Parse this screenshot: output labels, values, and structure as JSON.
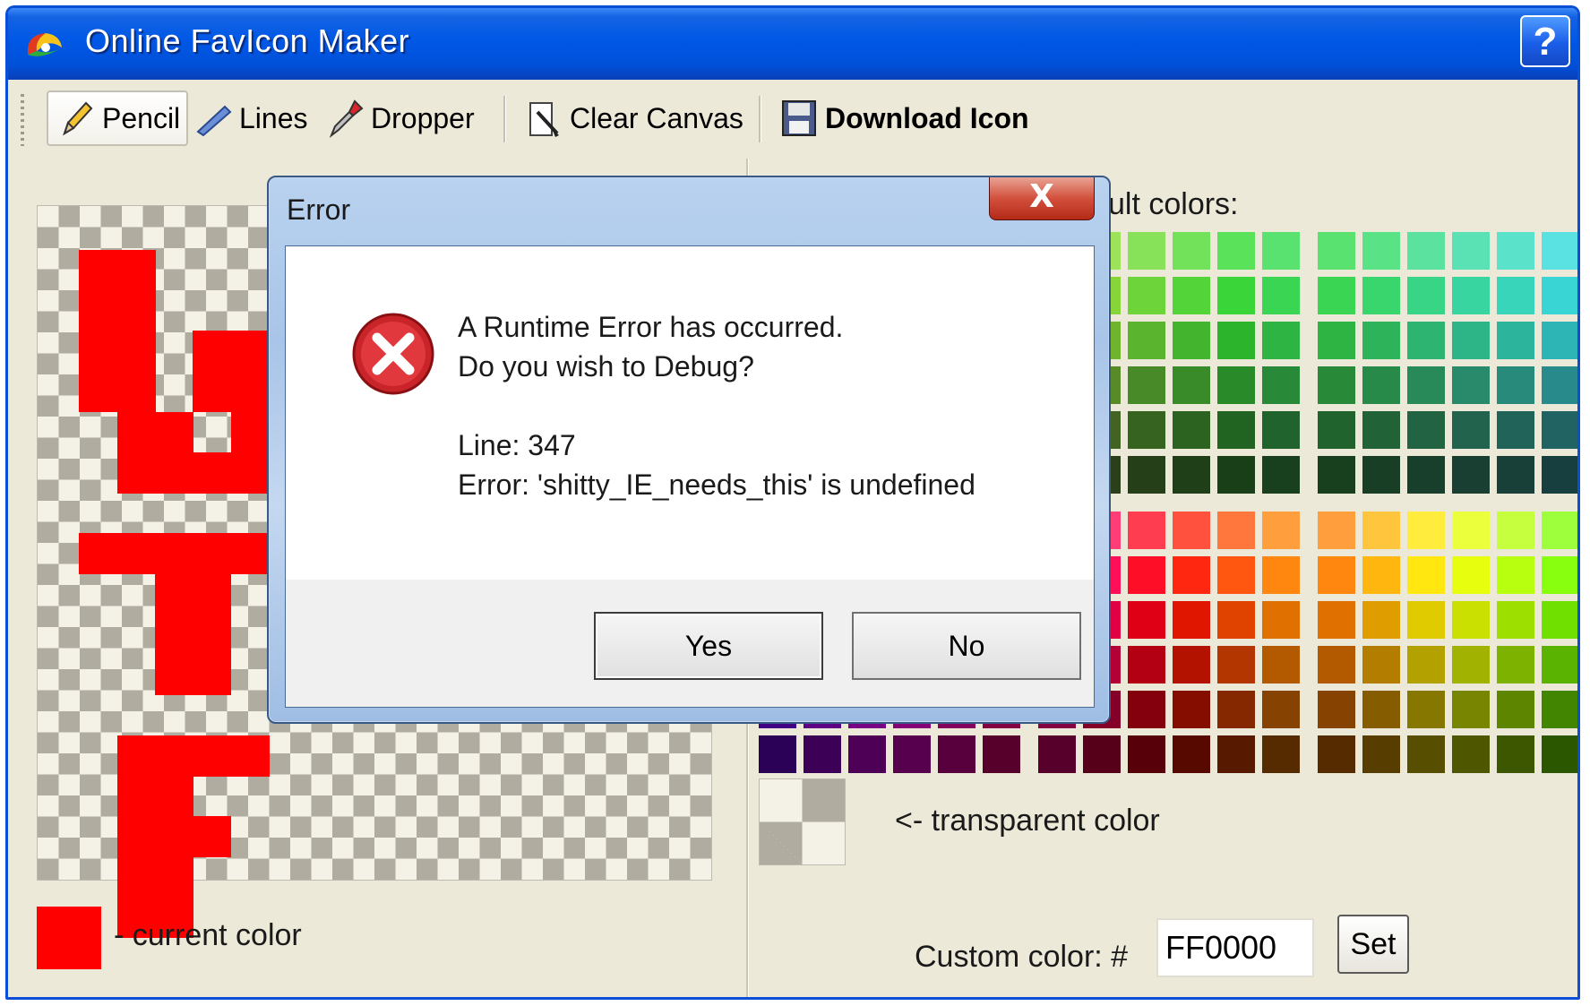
{
  "window": {
    "title": "Online FavIcon Maker",
    "help_label": "?"
  },
  "toolbar": {
    "pencil_label": "Pencil",
    "lines_label": "Lines",
    "dropper_label": "Dropper",
    "clear_label": "Clear Canvas",
    "download_label": "Download Icon"
  },
  "editor": {
    "current_color_label": "- current color",
    "current_color": "#FF0000",
    "palette_label": "ult colors:",
    "transparent_label": "<- transparent color",
    "custom_color_label": "Custom color: #",
    "custom_color_value": "FF0000",
    "set_label": "Set"
  },
  "dialog": {
    "title": "Error",
    "close_label": "X",
    "message_line1": "A Runtime Error has occurred.",
    "message_line2": "Do you wish to Debug?",
    "line_info": "Line: 347",
    "error_info": "Error: 'shitty_IE_needs_this' is undefined",
    "yes_label": "Yes",
    "no_label": "No"
  },
  "colors": {
    "titlebar": "#0058E6",
    "window_bg": "#ECE9D8",
    "drawing": "#FF0000"
  }
}
